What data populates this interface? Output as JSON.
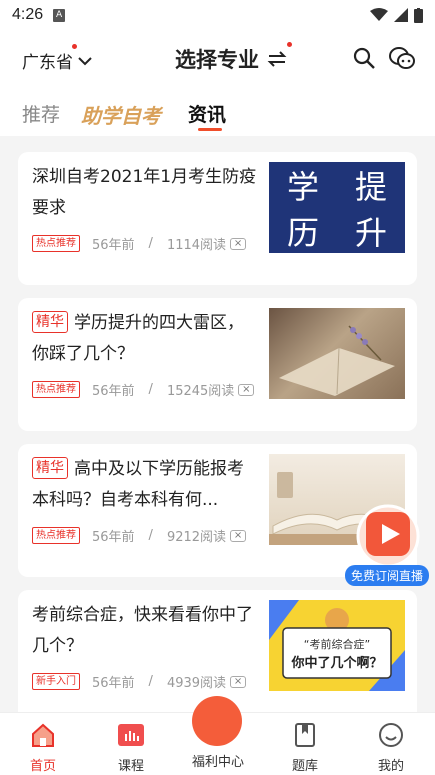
{
  "status": {
    "time": "4:26",
    "sim_label": "A"
  },
  "header": {
    "province": "广东省",
    "title": "选择专业",
    "accent": "#e8322a"
  },
  "tabs": [
    {
      "label": "推荐"
    },
    {
      "label": "助学自考"
    },
    {
      "label": "资讯"
    }
  ],
  "articles": [
    {
      "tag_inline": "",
      "title": "深圳自考2021年1月考生防疫要求",
      "tag": "热点推荐",
      "time": "56年前",
      "reads": "1114阅读",
      "thumb_text": [
        "学",
        "提",
        "历",
        "升"
      ]
    },
    {
      "tag_inline": "精华",
      "title": "学历提升的四大雷区，你踩了几个？",
      "tag": "热点推荐",
      "time": "56年前",
      "reads": "15245阅读"
    },
    {
      "tag_inline": "精华",
      "title": "高中及以下学历能报考本科吗？自考本科有何...",
      "tag": "热点推荐",
      "time": "56年前",
      "reads": "9212阅读"
    },
    {
      "tag_inline": "",
      "title": "考前综合症，快来看看你中了几个？",
      "tag": "新手入门",
      "time": "56年前",
      "reads": "4939阅读",
      "thumb_text": [
        "“考前综合症”",
        "你中了几个啊？"
      ]
    }
  ],
  "meta_sep": "/",
  "close_symbol": "×",
  "live_badge": "免费订阅直播",
  "bottom_nav": [
    {
      "label": "首页"
    },
    {
      "label": "课程"
    },
    {
      "label": "福利中心"
    },
    {
      "label": "题库"
    },
    {
      "label": "我的"
    }
  ]
}
